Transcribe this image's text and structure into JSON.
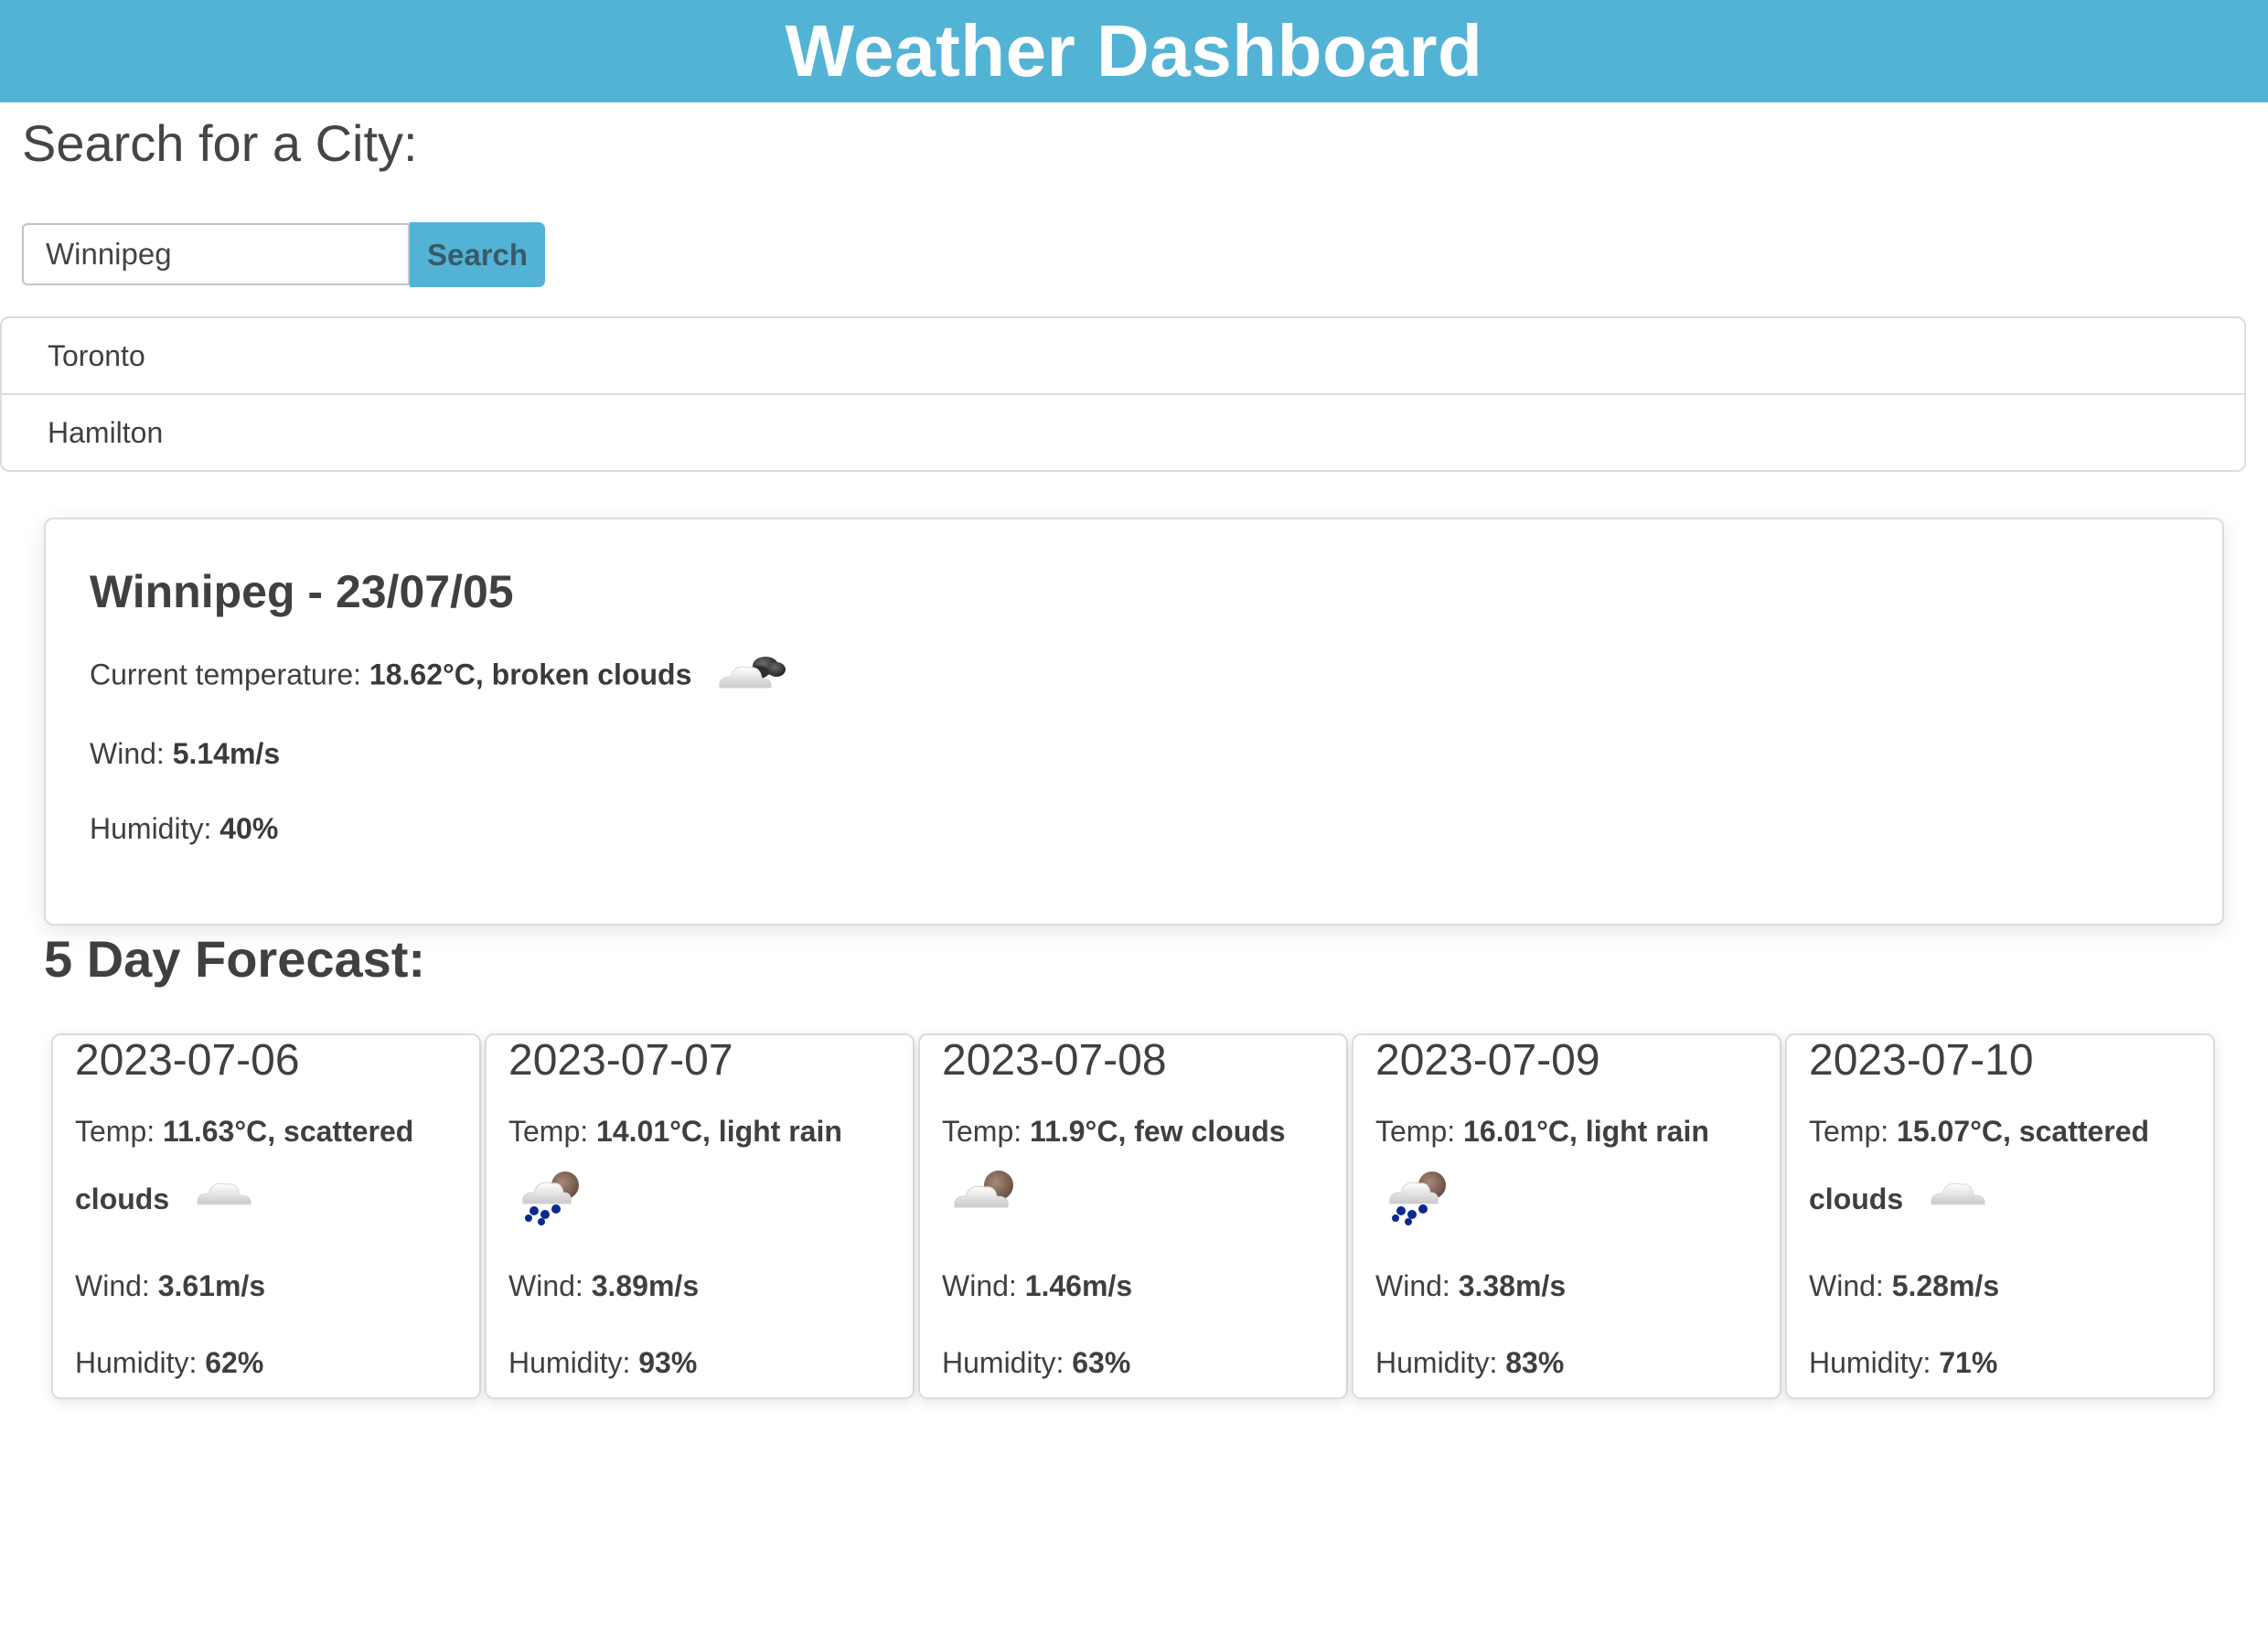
{
  "header": {
    "title": "Weather Dashboard"
  },
  "search": {
    "label": "Search for a City:",
    "value": "Winnipeg",
    "button_label": "Search"
  },
  "history": {
    "items": [
      {
        "label": "Toronto"
      },
      {
        "label": "Hamilton"
      }
    ]
  },
  "current": {
    "title": "Winnipeg - 23/07/05",
    "temp_label": "Current temperature: ",
    "temp_value": "18.62°C, broken clouds",
    "icon": "broken-clouds-icon",
    "wind_label": "Wind: ",
    "wind_value": "5.14m/s",
    "humidity_label": "Humidity: ",
    "humidity_value": "40%"
  },
  "forecast": {
    "title": "5 Day Forecast:",
    "temp_label": "Temp: ",
    "wind_label": "Wind: ",
    "humidity_label": "Humidity: ",
    "days": [
      {
        "date": "2023-07-06",
        "temp": "11.63°C, scattered clouds",
        "icon": "scattered-clouds-icon",
        "wind": "3.61m/s",
        "humidity": "62%"
      },
      {
        "date": "2023-07-07",
        "temp": "14.01°C, light rain",
        "icon": "light-rain-icon",
        "wind": "3.89m/s",
        "humidity": "93%"
      },
      {
        "date": "2023-07-08",
        "temp": "11.9°C, few clouds",
        "icon": "few-clouds-icon",
        "wind": "1.46m/s",
        "humidity": "63%"
      },
      {
        "date": "2023-07-09",
        "temp": "16.01°C, light rain",
        "icon": "light-rain-icon",
        "wind": "3.38m/s",
        "humidity": "83%"
      },
      {
        "date": "2023-07-10",
        "temp": "15.07°C, scattered clouds",
        "icon": "scattered-clouds-icon",
        "wind": "5.28m/s",
        "humidity": "71%"
      }
    ]
  },
  "colors": {
    "header_bg": "#53b3d5",
    "button_bg": "#53b3d5",
    "text": "#3a3a3a"
  }
}
